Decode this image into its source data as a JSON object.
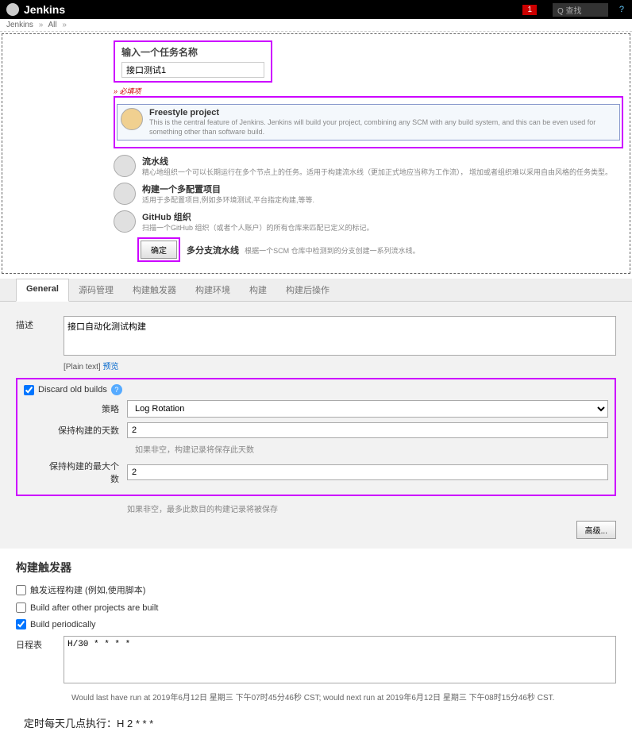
{
  "topbar": {
    "logo": "Jenkins",
    "alert_count": "1",
    "search_placeholder": "Q 查找"
  },
  "breadcrumb": {
    "items": [
      "Jenkins",
      "All"
    ]
  },
  "newitem": {
    "title": "输入一个任务名称",
    "value": "接口测试1",
    "required": "» 必填项"
  },
  "project_types": {
    "freestyle": {
      "name": "Freestyle project",
      "desc": "This is the central feature of Jenkins. Jenkins will build your project, combining any SCM with any build system, and this can be even used for something other than software build."
    },
    "pipeline": {
      "name": "流水线",
      "desc": "精心地组织一个可以长期运行在多个节点上的任务。适用于构建流水线（更加正式地应当称为工作流）， 增加或者组织难以采用自由风格的任务类型。"
    },
    "multi": {
      "name": "构建一个多配置项目",
      "desc": "适用于多配置项目,例如多环境测试,平台指定构建,等等."
    },
    "github": {
      "name": "GitHub 组织",
      "desc": "扫描一个GitHub 组织（或者个人账户）的所有仓库来匹配已定义的标记。"
    },
    "multibranch": {
      "name": "多分支流水线",
      "desc": "根据一个SCM 仓库中检测到的分支创建一系列流水线。"
    }
  },
  "ok_button": "确定",
  "tabs": [
    "General",
    "源码管理",
    "构建触发器",
    "构建环境",
    "构建",
    "构建后操作"
  ],
  "general": {
    "desc_label": "描述",
    "desc_value": "接口自动化测试构建",
    "plain_text": "[Plain text]",
    "preview": "预览",
    "discard_label": "Discard old builds",
    "strategy_label": "策略",
    "strategy_value": "Log Rotation",
    "days_label": "保持构建的天数",
    "days_value": "2",
    "days_hint": "如果非空，构建记录将保存此天数",
    "max_label": "保持构建的最大个数",
    "max_value": "2",
    "max_hint": "如果非空，最多此数目的构建记录将被保存",
    "advanced": "高级..."
  },
  "triggers": {
    "title": "构建触发器",
    "remote": "触发远程构建 (例如,使用脚本)",
    "after_other": "Build after other projects are built",
    "periodically": "Build periodically",
    "schedule_label": "日程表",
    "schedule_value": "H/30 * * * *",
    "schedule_hint": "Would last have run at 2019年6月12日 星期三 下午07时45分46秒 CST; would next run at 2019年6月12日 星期三 下午08时15分46秒 CST."
  },
  "bottom_note": "定时每天几点执行：H 2 * * *"
}
